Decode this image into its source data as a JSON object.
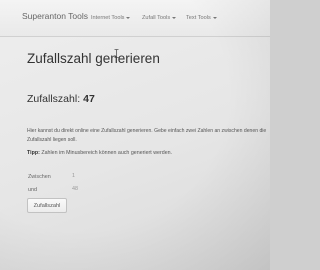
{
  "navbar": {
    "brand": "Superanton Tools",
    "items": [
      {
        "label": "Internet Tools"
      },
      {
        "label": "Zufall Tools"
      },
      {
        "label": "Text Tools"
      }
    ]
  },
  "main": {
    "title": "Zufallszahl generieren",
    "result_label": "Zufallszahl:",
    "result_value": "47",
    "intro_line1": "Hier kannst du direkt online eine Zufallszahl generieren. Gebe einfach zwei Zahlen an zwischen denen die",
    "intro_line2": "Zufallszahl liegen soll.",
    "tip_label": "Tipp:",
    "tip_text": "Zahlen im Minusbereich können auch generiert werden.",
    "form": {
      "min_label": "Zwischen",
      "min_value": "1",
      "max_label": "und",
      "max_value": "48",
      "submit_label": "Zufallszahl"
    }
  },
  "colors": {
    "page_background": "#e9e9e9",
    "navbar_background": "#f0f0f0",
    "text": "#333333"
  }
}
